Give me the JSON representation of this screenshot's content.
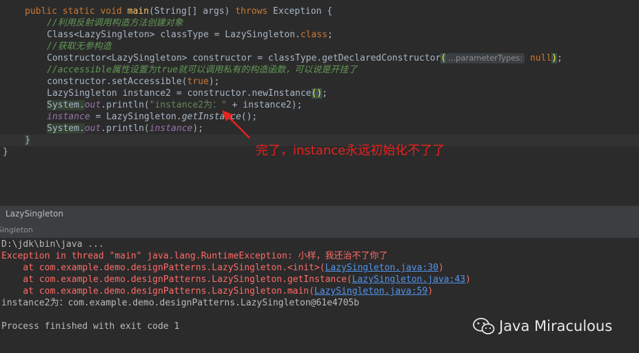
{
  "editor": {
    "lines": {
      "l1": {
        "kw1": "public static void ",
        "fn": "main",
        "rest": "(String[] args) ",
        "kw2": "throws",
        "rest2": " Exception {"
      },
      "l2": "//利用反射调用构造方法创建对象",
      "l3": {
        "a": "Class<LazySingleton> classType = LazySingleton.",
        "kw": "class",
        "b": ";"
      },
      "l4": "//获取无参构造",
      "l5": {
        "a": "Constructor<LazySingleton> constructor = classType.getDeclaredConstructor",
        "p1": "(",
        "hint": "...parameterTypes:",
        "kw": "null",
        "p2": ")",
        "b": ";"
      },
      "l6": {
        "a": "//accessible",
        "b": "属性设置为",
        "c": "true",
        "d": "就可以调用私有的构造函数，可以说是开挂了"
      },
      "l7": {
        "a": "constructor.setAccessible(",
        "kw": "true",
        "b": ");"
      },
      "l8": {
        "a": "LazySingleton instance2 = constructor.newInstance",
        "p": "()",
        "b": ";"
      },
      "l9": {
        "a": "System.",
        "fld": "out",
        "b": ".println(",
        "str": "\"instance2为：\"",
        "c": " + instance2);"
      },
      "l10": {
        "fld": "instance",
        "a": " = LazySingleton.",
        "fn": "getInstance",
        "b": "();"
      },
      "l11": {
        "a": "System.",
        "fld": "out",
        "b": ".println(",
        "fld2": "instance",
        "c": ");"
      },
      "l12": "}",
      "l13": "}"
    },
    "annotation": "完了，instance永远初始化不了了"
  },
  "run_panel": {
    "title": "LazySingleton",
    "tab": "Singleton",
    "console": {
      "cmd": "D:\\jdk\\bin\\java ...",
      "exception": "Exception in thread \"main\" java.lang.RuntimeException: 小样，我还治不了你了",
      "frames": [
        {
          "at": "    at com.example.demo.designPatterns.LazySingleton.<init>(",
          "link": "LazySingleton.java:30",
          "end": ")"
        },
        {
          "at": "    at com.example.demo.designPatterns.LazySingleton.getInstance(",
          "link": "LazySingleton.java:43",
          "end": ")"
        },
        {
          "at": "    at com.example.demo.designPatterns.LazySingleton.main(",
          "link": "LazySingleton.java:59",
          "end": ")"
        }
      ],
      "output": "instance2为：com.example.demo.designPatterns.LazySingleton@61e4705b",
      "finished": "Process finished with exit code 1"
    }
  },
  "watermark": {
    "text": "Java Miraculous",
    "icon": "wechat-icon"
  },
  "colors": {
    "error": "#ff6b68",
    "link": "#5394ec",
    "annotation": "#e8221f"
  }
}
